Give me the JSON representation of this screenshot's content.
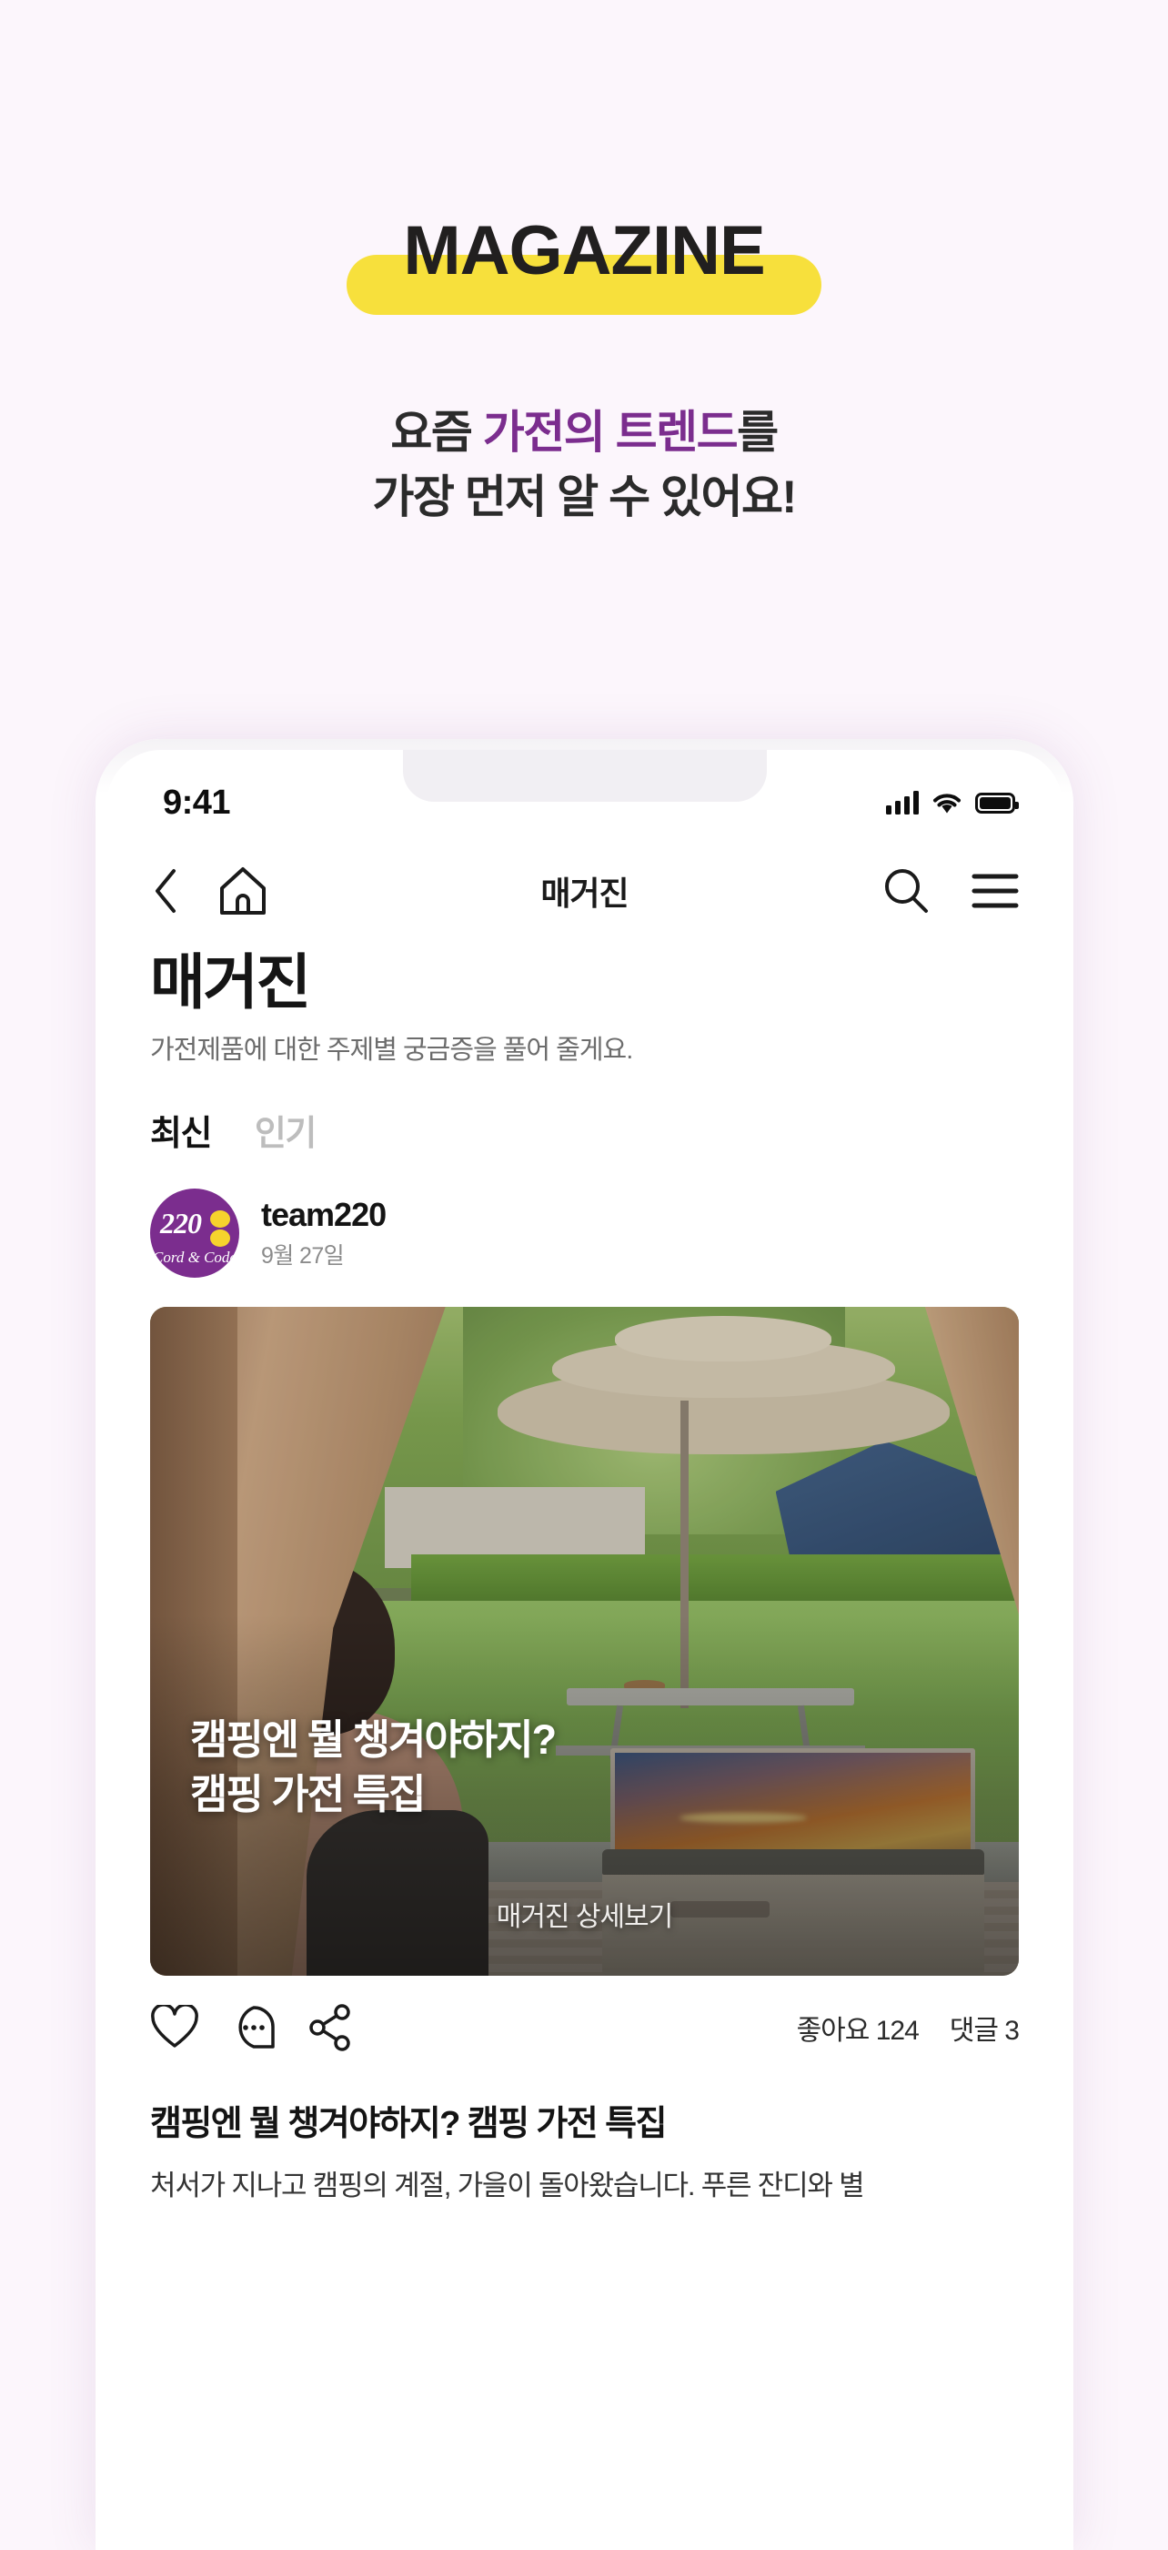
{
  "promo": {
    "badge_title": "MAGAZINE",
    "badge_color": "#f7e03c",
    "subtitle_line1_pre": "요즘 ",
    "subtitle_line1_hl": "가전의 트렌드",
    "subtitle_line1_post": "를",
    "subtitle_line2": "가장 먼저 알 수 있어요!",
    "accent_color": "#7b2d8e"
  },
  "status_bar": {
    "time": "9:41",
    "signal_icon": "cellular-signal-icon",
    "wifi_icon": "wifi-icon",
    "battery_icon": "battery-full-icon"
  },
  "navbar": {
    "back_icon": "chevron-left-icon",
    "home_icon": "home-icon",
    "title": "매거진",
    "search_icon": "search-icon",
    "menu_icon": "hamburger-menu-icon"
  },
  "page": {
    "title": "매거진",
    "subtitle": "가전제품에 대한 주제별 궁금증을 풀어 줄게요."
  },
  "tabs": [
    {
      "label": "최신",
      "active": true
    },
    {
      "label": "인기",
      "active": false
    }
  ],
  "author": {
    "avatar_text": "220",
    "avatar_tagline": "Cord & Code",
    "avatar_bg": "#7b2d8e",
    "avatar_accent": "#f6d32d",
    "name": "team220",
    "date": "9월 27일"
  },
  "card": {
    "overlay_title_line1": "캠핑엔 뭘 챙겨야하지?",
    "overlay_title_line2": "캠핑 가전 특집",
    "overlay_cta": "매거진 상세보기"
  },
  "actions": {
    "like_icon": "heart-icon",
    "comment_icon": "comment-bubble-icon",
    "share_icon": "share-icon",
    "like_count": "좋아요 124",
    "comment_count": "댓글 3"
  },
  "post": {
    "title": "캠핑엔 뭘 챙겨야하지? 캠핑 가전 특집",
    "body": "처서가 지나고 캠핑의 계절, 가을이 돌아왔습니다. 푸른 잔디와 별"
  }
}
